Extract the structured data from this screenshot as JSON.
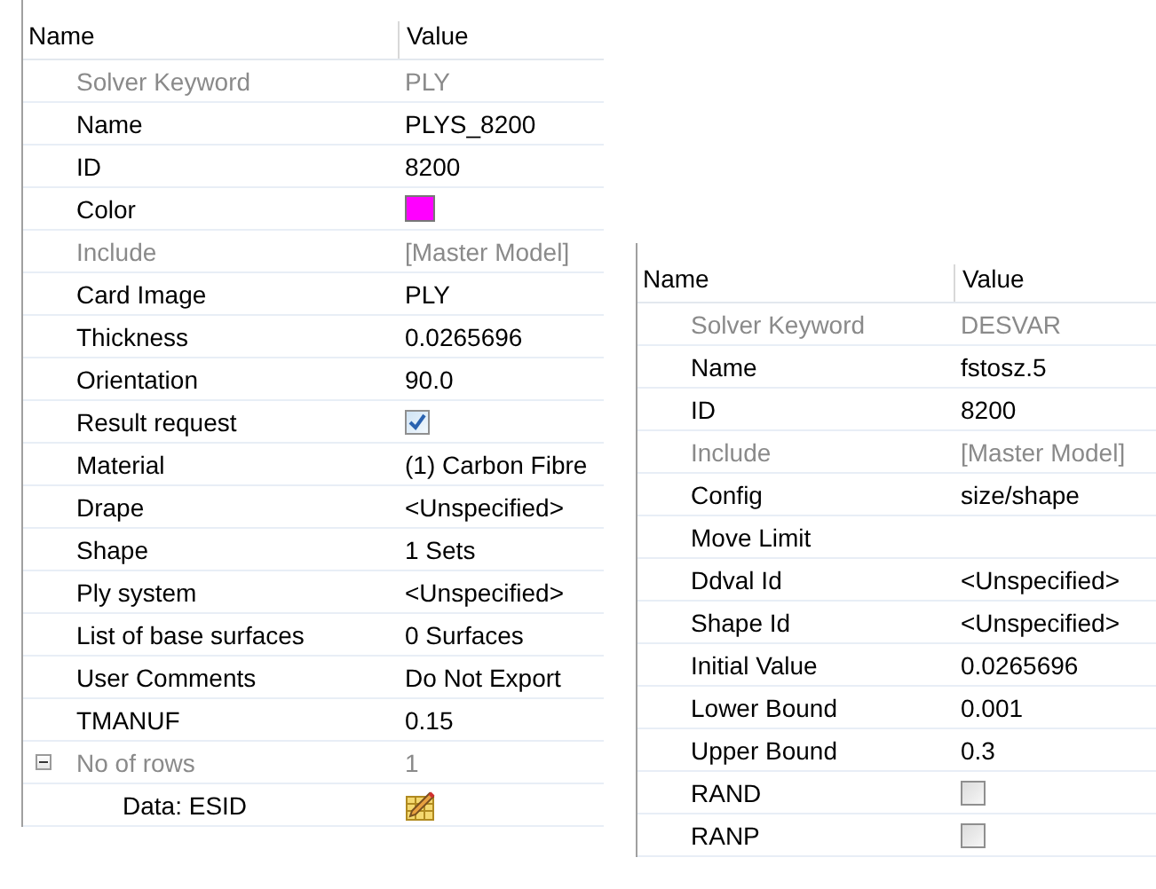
{
  "panels": [
    {
      "columns": [
        "Name",
        "Value"
      ],
      "rows": [
        {
          "kind": "text",
          "label": "Solver Keyword",
          "value": "PLY",
          "disabled": true
        },
        {
          "kind": "text",
          "label": "Name",
          "value": "PLYS_8200",
          "disabled": false
        },
        {
          "kind": "text",
          "label": "ID",
          "value": "8200",
          "disabled": false
        },
        {
          "kind": "color",
          "label": "Color",
          "color": "#ff00ff",
          "disabled": false
        },
        {
          "kind": "text",
          "label": "Include",
          "value": "[Master Model]",
          "disabled": true
        },
        {
          "kind": "text",
          "label": "Card Image",
          "value": "PLY",
          "disabled": false
        },
        {
          "kind": "text",
          "label": "Thickness",
          "value": "0.0265696",
          "disabled": false
        },
        {
          "kind": "text",
          "label": "Orientation",
          "value": "90.0",
          "disabled": false
        },
        {
          "kind": "checkbox",
          "label": "Result request",
          "checked": true,
          "disabled": false
        },
        {
          "kind": "text",
          "label": "Material",
          "value": "(1) Carbon Fibre",
          "disabled": false
        },
        {
          "kind": "text",
          "label": "Drape",
          "value": "<Unspecified>",
          "disabled": false
        },
        {
          "kind": "text",
          "label": "Shape",
          "value": "1 Sets",
          "disabled": false
        },
        {
          "kind": "text",
          "label": "Ply system",
          "value": "<Unspecified>",
          "disabled": false
        },
        {
          "kind": "text",
          "label": "List of base surfaces",
          "value": "0 Surfaces",
          "disabled": false
        },
        {
          "kind": "text",
          "label": "User Comments",
          "value": "Do Not Export",
          "disabled": false
        },
        {
          "kind": "text",
          "label": "TMANUF",
          "value": "0.15",
          "disabled": false
        },
        {
          "kind": "group",
          "label": "No of rows",
          "value": "1",
          "disabled": true,
          "expanded": true,
          "children": [
            {
              "kind": "icon",
              "label": "Data: ESID",
              "disabled": false
            }
          ]
        }
      ]
    },
    {
      "columns": [
        "Name",
        "Value"
      ],
      "rows": [
        {
          "kind": "text",
          "label": "Solver Keyword",
          "value": "DESVAR",
          "disabled": true
        },
        {
          "kind": "text",
          "label": "Name",
          "value": "fstosz.5",
          "disabled": false
        },
        {
          "kind": "text",
          "label": "ID",
          "value": "8200",
          "disabled": false
        },
        {
          "kind": "text",
          "label": "Include",
          "value": "[Master Model]",
          "disabled": true
        },
        {
          "kind": "text",
          "label": "Config",
          "value": "size/shape",
          "disabled": false
        },
        {
          "kind": "text",
          "label": "Move Limit",
          "disabled": false
        },
        {
          "kind": "text",
          "label": "Ddval Id",
          "value": "<Unspecified>",
          "disabled": false
        },
        {
          "kind": "text",
          "label": "Shape Id",
          "value": "<Unspecified>",
          "disabled": false
        },
        {
          "kind": "text",
          "label": "Initial Value",
          "value": "0.0265696",
          "disabled": false
        },
        {
          "kind": "text",
          "label": "Lower Bound",
          "value": "0.001",
          "disabled": false
        },
        {
          "kind": "text",
          "label": "Upper Bound",
          "value": "0.3",
          "disabled": false
        },
        {
          "kind": "checkbox",
          "label": "RAND",
          "checked": false,
          "disabled": false
        },
        {
          "kind": "checkbox",
          "label": "RANP",
          "checked": false,
          "disabled": false
        }
      ]
    }
  ]
}
